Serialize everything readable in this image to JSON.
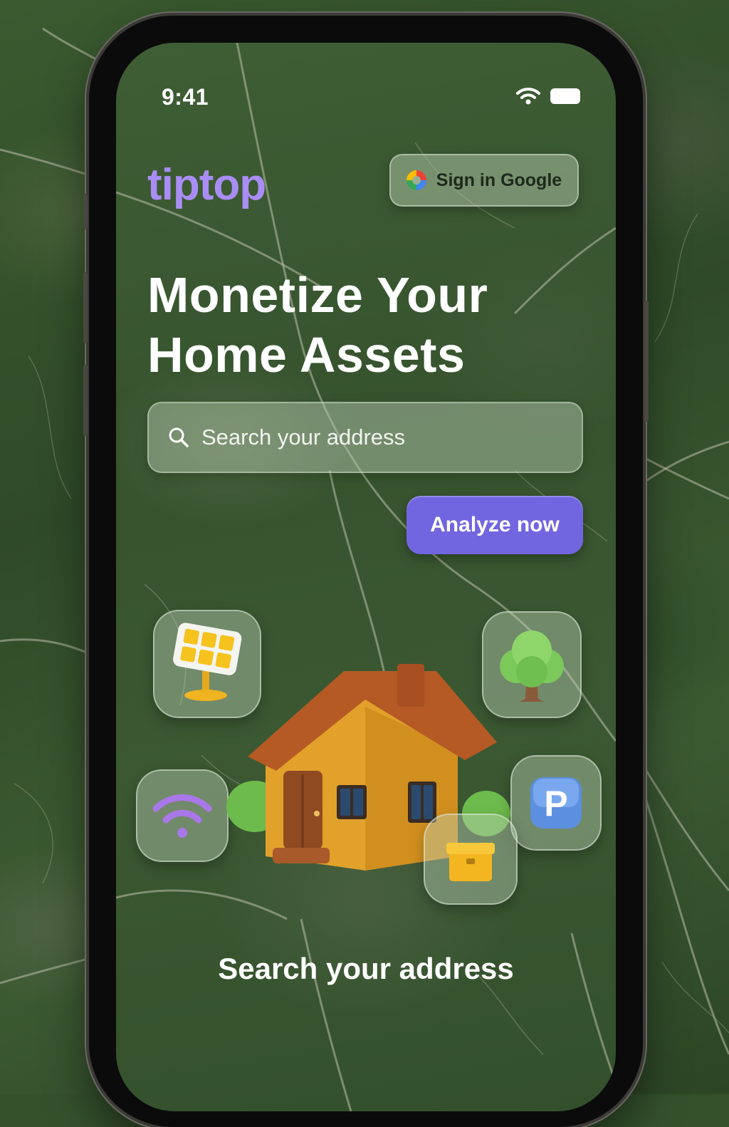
{
  "status_bar": {
    "time": "9:41"
  },
  "header": {
    "logo": "tiptop",
    "google_button_label": "Sign in Google"
  },
  "hero": {
    "headline_line1": "Monetize Your",
    "headline_line2": "Home Assets"
  },
  "search": {
    "placeholder": "Search your address",
    "value": ""
  },
  "actions": {
    "analyze_label": "Analyze now"
  },
  "asset_icons": [
    "solar-panel-icon",
    "tree-icon",
    "wifi-icon",
    "parking-icon",
    "storage-box-icon",
    "house-icon"
  ],
  "footer": {
    "caption": "Search your address"
  },
  "colors": {
    "brand": "#a98df5",
    "primary_button": "#7266e0",
    "map_green": "#3b5832"
  }
}
